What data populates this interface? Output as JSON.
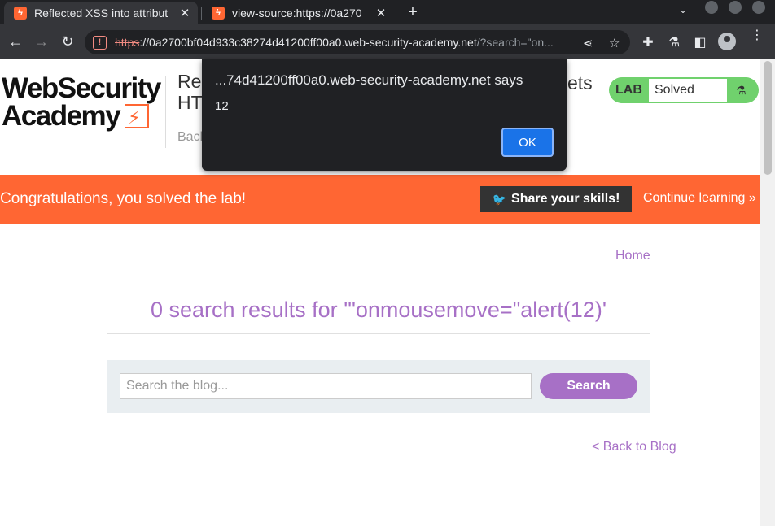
{
  "browser": {
    "tabs": [
      {
        "title": "Reflected XSS into attribut",
        "active": true
      },
      {
        "title": "view-source:https://0a270",
        "active": false
      }
    ],
    "url": {
      "scheme": "https",
      "host": "://0a2700bf04d933c38274d41200ff00a0.web-security-academy.net",
      "path": "/?search=\"on..."
    }
  },
  "site": {
    "logo_line1": "WebSecurity",
    "logo_line2": "Academy",
    "lab_title_start": "Re",
    "lab_title_end": "ets",
    "lab_title_line2": "HT",
    "back_link": "Back",
    "status_label": "LAB",
    "status_value": "Solved"
  },
  "banner": {
    "message": "Congratulations, you solved the lab!",
    "share_label": "Share your skills!",
    "continue_label": "Continue learning"
  },
  "main": {
    "home_link": "Home",
    "heading": "0 search results for '\"onmousemove=\"alert(12)'",
    "search_placeholder": "Search the blog...",
    "search_button": "Search",
    "back_to_blog": "< Back to Blog"
  },
  "dialog": {
    "title": "...74d41200ff00a0.web-security-academy.net says",
    "message": "12",
    "ok_label": "OK"
  },
  "colors": {
    "accent": "#ff6633",
    "link": "#a770c6",
    "solved": "#70d16d",
    "dialog_button": "#1a73e8"
  }
}
